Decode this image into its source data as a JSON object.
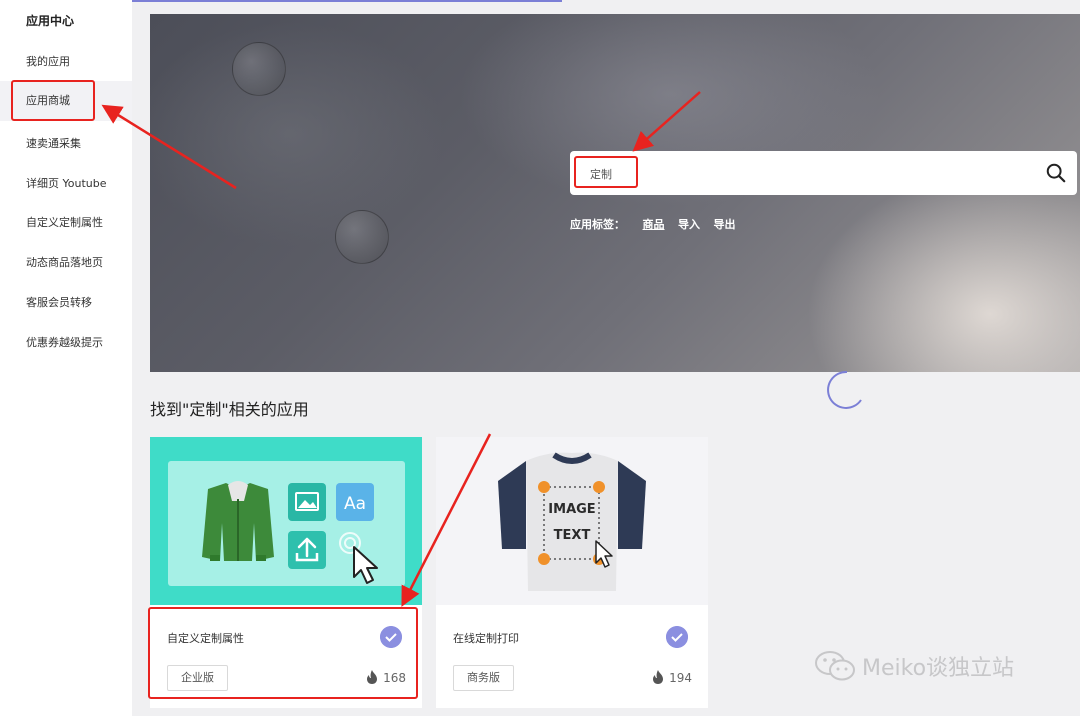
{
  "sidebar": {
    "title": "应用中心",
    "items": [
      {
        "label": "我的应用"
      },
      {
        "label": "应用商城"
      },
      {
        "label": "速卖通采集"
      },
      {
        "label": "详细页 Youtube"
      },
      {
        "label": "自定义定制属性"
      },
      {
        "label": "动态商品落地页"
      },
      {
        "label": "客服会员转移"
      },
      {
        "label": "优惠券越级提示"
      }
    ]
  },
  "search": {
    "value": "定制"
  },
  "tags": {
    "label": "应用标签：",
    "items": [
      "商品",
      "导入",
      "导出"
    ]
  },
  "results": {
    "title": "找到\"定制\"相关的应用",
    "cards": [
      {
        "name": "自定义定制属性",
        "badge": "企业版",
        "count": "168"
      },
      {
        "name": "在线定制打印",
        "badge": "商务版",
        "count": "194",
        "image_text": [
          "IMAGE",
          "TEXT"
        ]
      }
    ]
  },
  "watermark": "Meiko谈独立站",
  "colors": {
    "accent": "#8b8fe0",
    "card1_bg": "#3fdcc8",
    "annotation": "#e8231f"
  }
}
